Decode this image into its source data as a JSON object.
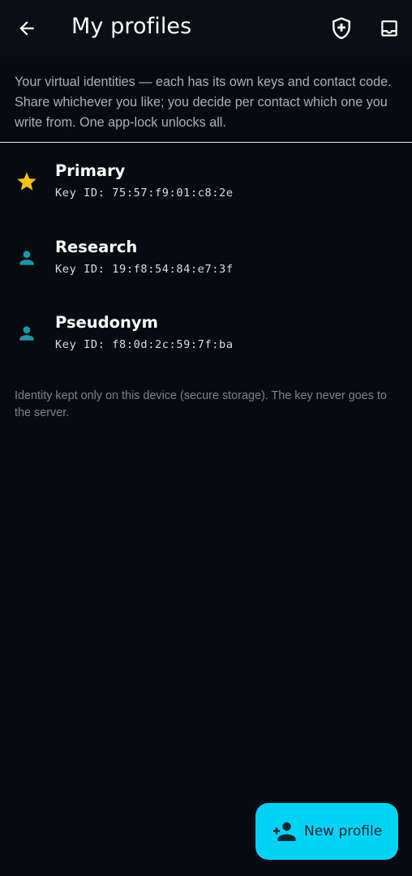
{
  "appbar": {
    "title": "My profiles",
    "icons": {
      "back": "arrow-back-icon",
      "shield": "shield-plus-icon",
      "inbox": "inbox-icon"
    }
  },
  "intro": {
    "text": "Your virtual identities — each has its own keys and contact code. Share whichever you like; you decide per contact which one you write from. One app-lock unlocks all."
  },
  "profiles": [
    {
      "name": "Primary",
      "key": "Key ID: 75:57:f9:01:c8:2e",
      "icon": "star-icon"
    },
    {
      "name": "Research",
      "key": "Key ID: 19:f8:54:84:e7:3f",
      "icon": "person-icon"
    },
    {
      "name": "Pseudonym",
      "key": "Key ID: f8:0d:2c:59:7f:ba",
      "icon": "person-icon"
    }
  ],
  "footnote": "Identity kept only on this device (secure storage). The key never goes to the server.",
  "fab": {
    "label": "New profile",
    "icon": "person-add-icon"
  },
  "colors": {
    "background": "#070b0f",
    "appbar": "#0b0f13",
    "accent": "#00d2f6",
    "star": "#f6c21a",
    "person": "#1a98a8"
  }
}
